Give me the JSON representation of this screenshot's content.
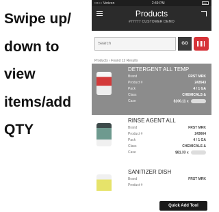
{
  "caption": {
    "lines": [
      "Swipe up/",
      "down to",
      "view",
      "items/add",
      "QTY"
    ]
  },
  "status_bar": {
    "carrier": "•••○○ Verizon",
    "time": "2:49 PM"
  },
  "header": {
    "title": "Products",
    "subtitle": "#77777 CUSTOMER DEMO"
  },
  "search": {
    "placeholder": "Search",
    "go_label": "GO"
  },
  "breadcrumb": "Products › Found 12 Results",
  "products": [
    {
      "name": "DETERGENT ALL TEMP",
      "fields": [
        {
          "label": "Brand",
          "value": "FRST MRK"
        },
        {
          "label": "Product #",
          "value": "243543"
        },
        {
          "label": "Pack",
          "value": "4 / 1 GA"
        },
        {
          "label": "Class",
          "value": "CHEMICALS &"
        },
        {
          "label": "Case",
          "value": "$100.11 x"
        }
      ],
      "image_color": "#d33a3a",
      "selected": true
    },
    {
      "name": "RINSE AGENT ALL",
      "fields": [
        {
          "label": "Brand",
          "value": "FRST MRK"
        },
        {
          "label": "Product #",
          "value": "243664"
        },
        {
          "label": "Pack",
          "value": "4 / 1 GA"
        },
        {
          "label": "Class",
          "value": "CHEMICALS &"
        },
        {
          "label": "Case",
          "value": "$81.33 x"
        }
      ],
      "image_color": "#6e9a8f",
      "selected": false
    },
    {
      "name": "SANITIZER DISH",
      "fields": [
        {
          "label": "Brand",
          "value": "FRST MRK"
        },
        {
          "label": "Product #",
          "value": ""
        }
      ],
      "image_color": "#e6e36a",
      "selected": false
    }
  ],
  "quick_add_label": "Quick Add Tool",
  "colors": {
    "header_bg": "#2b2b2b",
    "selected_row": "#8c8c8c",
    "barcode_button": "#d63338"
  }
}
